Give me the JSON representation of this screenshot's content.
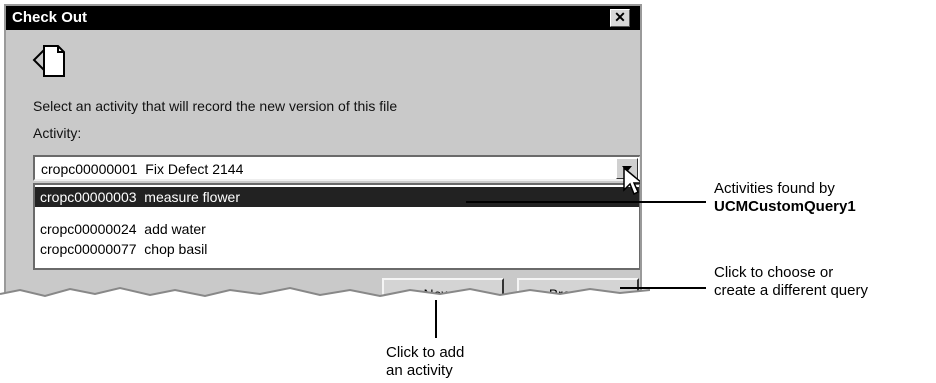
{
  "dialog": {
    "title": "Check Out",
    "close_glyph": "✕",
    "prompt": "Select an activity that will record the new version of this file",
    "activity_label": "Activity:",
    "combo_value": "cropc00000001  Fix Defect 2144",
    "list_items": [
      "cropc00000003  measure flower",
      "cropc00000024  add water",
      "cropc00000077  chop basil"
    ],
    "selected_index": 0,
    "new_button": "New...",
    "browse_button": "Browse..."
  },
  "annotations": {
    "activities_line1": "Activities found by",
    "activities_line2": "UCMCustomQuery1",
    "browse_line1": "Click to choose or",
    "browse_line2": "create a different query",
    "new_line1": "Click to add",
    "new_line2": "an activity"
  },
  "icons": {
    "close": "close-icon",
    "checkout": "checkout-arrow-icon",
    "dropdown": "chevron-down-icon",
    "cursor": "mouse-pointer-icon"
  }
}
